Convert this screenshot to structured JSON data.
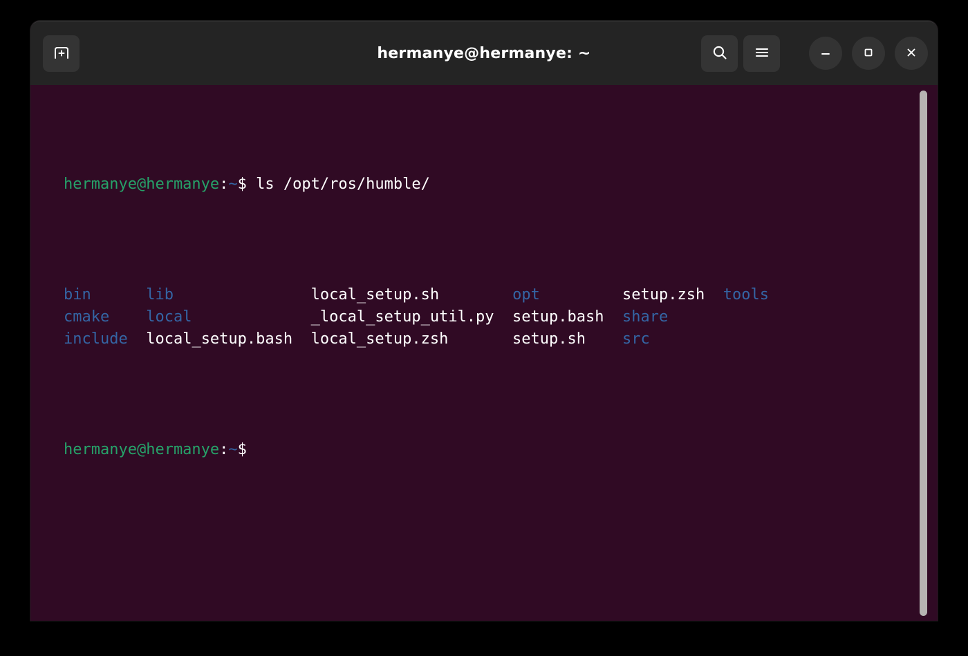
{
  "window": {
    "title": "hermanye@hermanye: ~",
    "colors": {
      "titlebar_bg": "#242424",
      "terminal_bg": "#300a24",
      "desktop_bg": "#000000",
      "prompt_green": "#26a269",
      "dir_blue": "#3465a4",
      "text_white": "#ffffff",
      "scrollbar": "#b6b4b2"
    }
  },
  "titlebar": {
    "new_tab_label": "New Tab",
    "search_label": "Search",
    "menu_label": "Main Menu",
    "minimize_label": "Minimize",
    "maximize_label": "Maximize",
    "close_label": "Close",
    "icons": {
      "new_tab": "new-tab-icon",
      "search": "search-icon",
      "menu": "hamburger-menu-icon",
      "minimize": "minimize-icon",
      "maximize": "maximize-icon",
      "close": "close-icon"
    }
  },
  "terminal": {
    "prompt": {
      "user_host": "hermanye@hermanye",
      "separator": ":",
      "path": "~",
      "sigil": "$"
    },
    "command": " ls /opt/ros/humble/",
    "listing_rows": [
      [
        {
          "text": "bin",
          "type": "dir",
          "col": 0
        },
        {
          "text": "lib",
          "type": "dir",
          "col": 9
        },
        {
          "text": "local_setup.sh",
          "type": "file",
          "col": 27
        },
        {
          "text": "opt",
          "type": "dir",
          "col": 49
        },
        {
          "text": "setup.zsh",
          "type": "file",
          "col": 61
        },
        {
          "text": "tools",
          "type": "dir",
          "col": 72
        }
      ],
      [
        {
          "text": "cmake",
          "type": "dir",
          "col": 0
        },
        {
          "text": "local",
          "type": "dir",
          "col": 9
        },
        {
          "text": "_local_setup_util.py",
          "type": "file",
          "col": 27
        },
        {
          "text": "setup.bash",
          "type": "file",
          "col": 49
        },
        {
          "text": "share",
          "type": "dir",
          "col": 61
        }
      ],
      [
        {
          "text": "include",
          "type": "dir",
          "col": 0
        },
        {
          "text": "local_setup.bash",
          "type": "file",
          "col": 9
        },
        {
          "text": "local_setup.zsh",
          "type": "file",
          "col": 27
        },
        {
          "text": "setup.sh",
          "type": "file",
          "col": 49
        },
        {
          "text": "src",
          "type": "dir",
          "col": 61
        }
      ]
    ],
    "scrollbar": {
      "position_label": "bottom"
    }
  }
}
